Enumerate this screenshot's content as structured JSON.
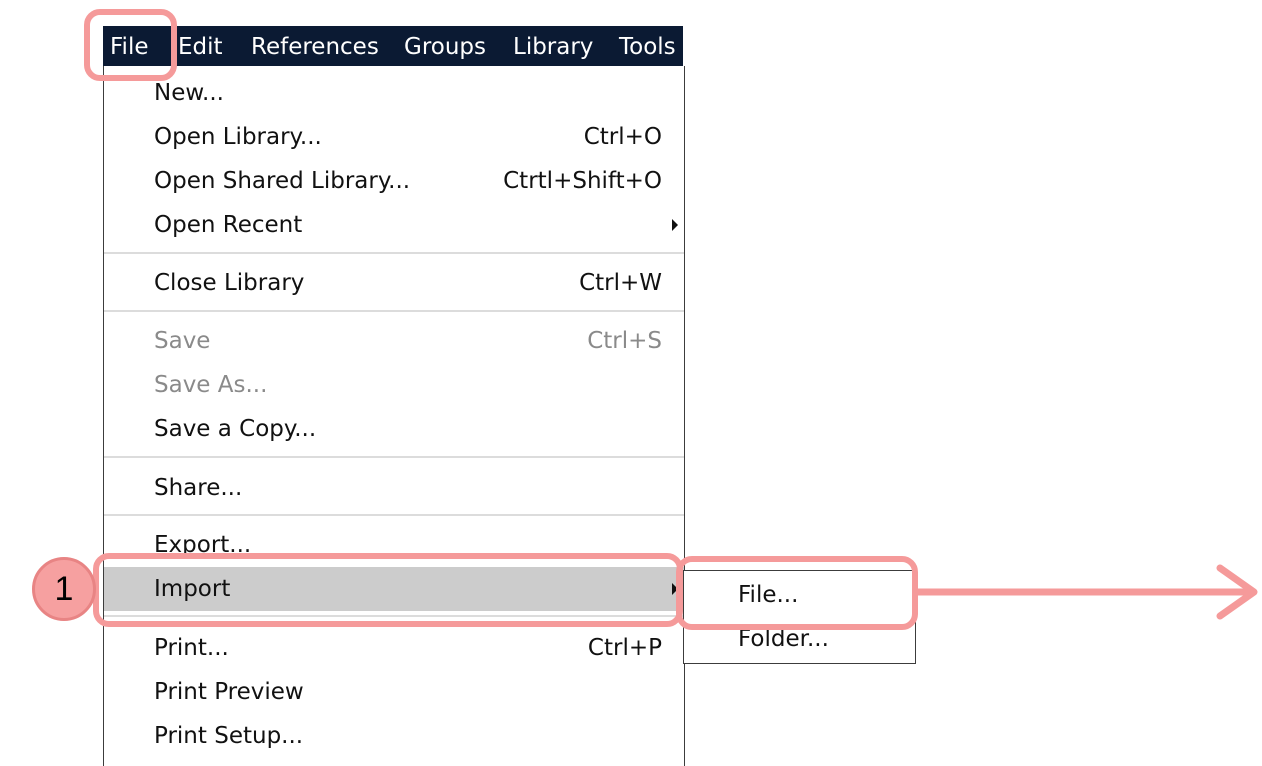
{
  "menubar": {
    "items": [
      "File",
      "Edit",
      "References",
      "Groups",
      "Library",
      "Tools"
    ]
  },
  "file_menu": {
    "items": [
      {
        "label": "New...",
        "shortcut": ""
      },
      {
        "label": "Open Library...",
        "shortcut": "Ctrl+O"
      },
      {
        "label": "Open Shared Library...",
        "shortcut": "Ctrtl+Shift+O"
      },
      {
        "label": "Open Recent",
        "shortcut": "",
        "submenu": true
      },
      {
        "label": "Close Library",
        "shortcut": "Ctrl+W"
      },
      {
        "label": "Save",
        "shortcut": "Ctrl+S",
        "disabled": true
      },
      {
        "label": "Save As...",
        "shortcut": "",
        "disabled": true
      },
      {
        "label": "Save a Copy...",
        "shortcut": ""
      },
      {
        "label": "Share...",
        "shortcut": ""
      },
      {
        "label": "Export...",
        "shortcut": ""
      },
      {
        "label": "Import",
        "shortcut": "",
        "submenu": true,
        "highlighted": true
      },
      {
        "label": "Print...",
        "shortcut": "Ctrl+P"
      },
      {
        "label": "Print Preview",
        "shortcut": ""
      },
      {
        "label": "Print Setup...",
        "shortcut": ""
      }
    ]
  },
  "import_submenu": {
    "items": [
      "File...",
      "Folder..."
    ]
  },
  "annotation": {
    "step_number": "1",
    "highlight_color": "#f59a9a"
  },
  "colors": {
    "menubar_bg": "#0b1a33",
    "highlight_bg": "#cccccc",
    "disabled_text": "#8a8a8a"
  }
}
